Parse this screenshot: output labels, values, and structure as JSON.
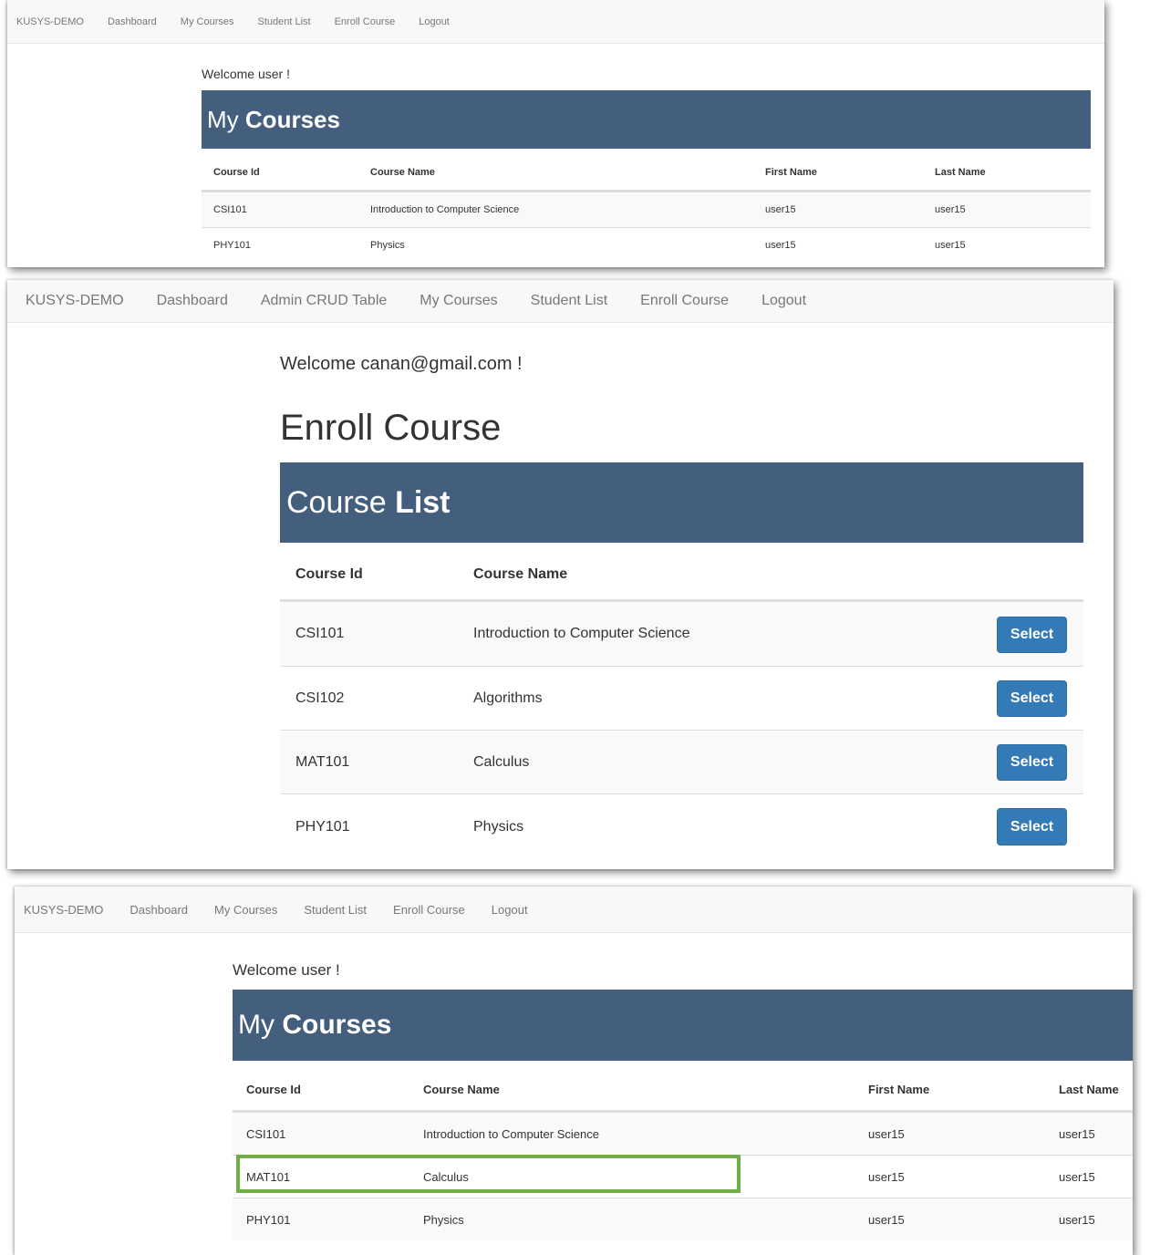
{
  "screen1": {
    "nav": {
      "brand": "KUSYS-DEMO",
      "items": [
        "Dashboard",
        "My Courses",
        "Student List",
        "Enroll Course",
        "Logout"
      ]
    },
    "welcome": "Welcome user !",
    "heading_light": "My",
    "heading_bold": "Courses",
    "columns": [
      "Course Id",
      "Course Name",
      "First Name",
      "Last Name"
    ],
    "rows": [
      [
        "CSI101",
        "Introduction to Computer Science",
        "user15",
        "user15"
      ],
      [
        "PHY101",
        "Physics",
        "user15",
        "user15"
      ]
    ]
  },
  "screen2": {
    "nav": {
      "brand": "KUSYS-DEMO",
      "items": [
        "Dashboard",
        "Admin CRUD Table",
        "My Courses",
        "Student List",
        "Enroll Course",
        "Logout"
      ]
    },
    "welcome": "Welcome canan@gmail.com !",
    "page_title": "Enroll Course",
    "heading_light": "Course",
    "heading_bold": "List",
    "columns": [
      "Course Id",
      "Course Name"
    ],
    "select_label": "Select",
    "rows": [
      [
        "CSI101",
        "Introduction to Computer Science"
      ],
      [
        "CSI102",
        "Algorithms"
      ],
      [
        "MAT101",
        "Calculus"
      ],
      [
        "PHY101",
        "Physics"
      ]
    ]
  },
  "screen3": {
    "nav": {
      "brand": "KUSYS-DEMO",
      "items": [
        "Dashboard",
        "My Courses",
        "Student List",
        "Enroll Course",
        "Logout"
      ]
    },
    "welcome": "Welcome user !",
    "heading_light": "My",
    "heading_bold": "Courses",
    "columns": [
      "Course Id",
      "Course Name",
      "First Name",
      "Last Name"
    ],
    "rows": [
      [
        "CSI101",
        "Introduction to Computer Science",
        "user15",
        "user15"
      ],
      [
        "MAT101",
        "Calculus",
        "user15",
        "user15"
      ],
      [
        "PHY101",
        "Physics",
        "user15",
        "user15"
      ]
    ],
    "highlight_color": "#70ad47"
  },
  "colors": {
    "header_bg": "#445f7e",
    "button_bg": "#337ab7",
    "navbar_bg": "#f8f8f8"
  }
}
